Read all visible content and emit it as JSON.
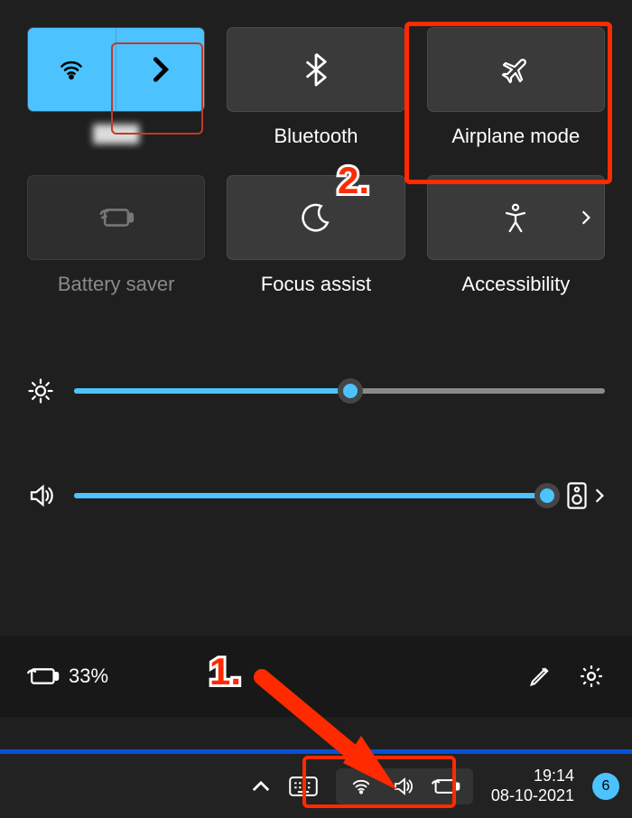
{
  "tiles": {
    "wifi": {
      "label": "",
      "network_name": "████"
    },
    "bluetooth": {
      "label": "Bluetooth"
    },
    "airplane": {
      "label": "Airplane mode"
    },
    "battery_saver": {
      "label": "Battery saver"
    },
    "focus_assist": {
      "label": "Focus assist"
    },
    "accessibility": {
      "label": "Accessibility"
    }
  },
  "sliders": {
    "brightness_percent": 52,
    "volume_percent": 100
  },
  "bottom": {
    "battery_text": "33%"
  },
  "taskbar": {
    "time": "19:14",
    "date": "08-10-2021",
    "notification_count": "6"
  },
  "annotations": {
    "step1": "1.",
    "step2": "2."
  },
  "colors": {
    "accent": "#4cc2ff",
    "highlight": "#ff2a00"
  }
}
